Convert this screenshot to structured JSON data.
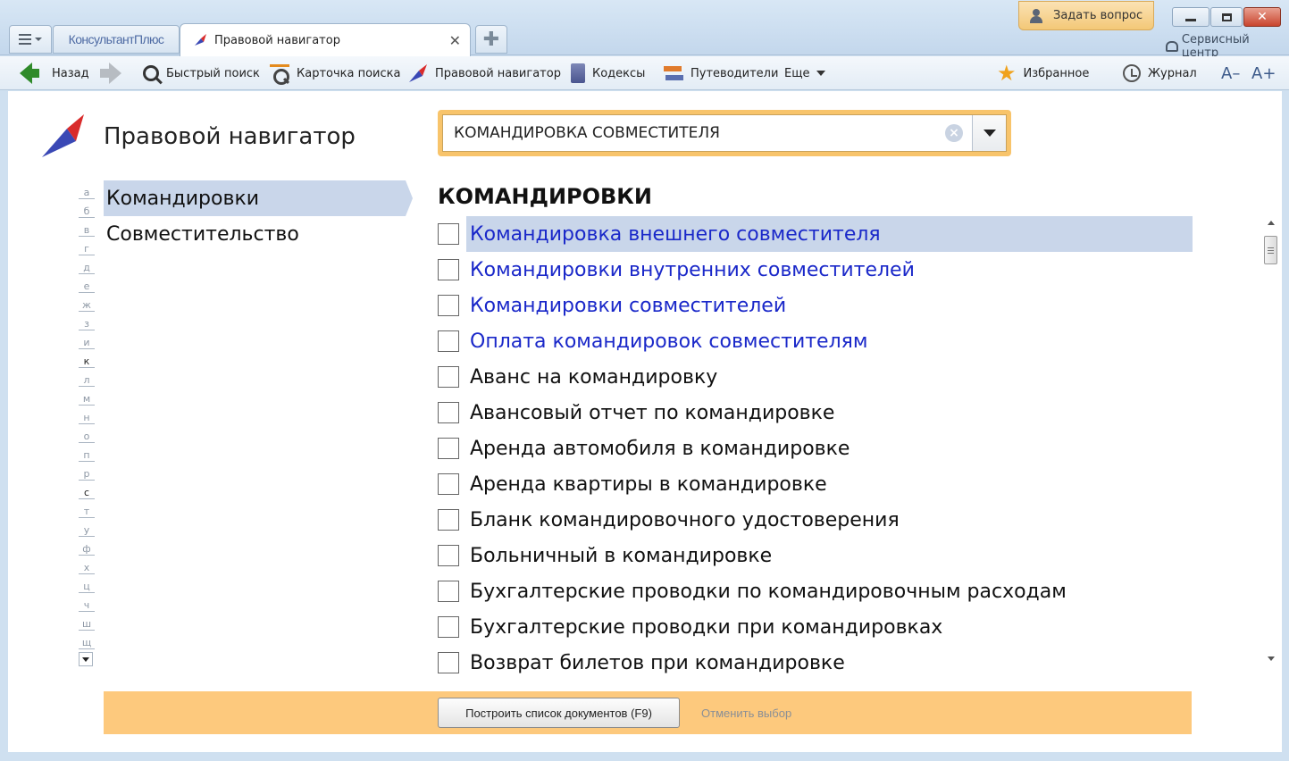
{
  "titlebar": {
    "home_tab": "КонсультантПлюс",
    "active_tab": "Правовой навигатор",
    "ask_button": "Задать вопрос",
    "service_center": "Сервисный центр"
  },
  "toolbar": {
    "back": "Назад",
    "quick_search": "Быстрый поиск",
    "search_card": "Карточка поиска",
    "legal_navigator": "Правовой навигатор",
    "codes": "Кодексы",
    "guides": "Путеводители",
    "more": "Еще",
    "favorites": "Избранное",
    "journal": "Журнал",
    "font_smaller": "A–",
    "font_larger": "A+"
  },
  "page": {
    "title": "Правовой навигатор",
    "search_value": "КОМАНДИРОВКА СОВМЕСТИТЕЛЯ"
  },
  "alphabet": [
    {
      "letter": "а",
      "on": false
    },
    {
      "letter": "б",
      "on": false
    },
    {
      "letter": "в",
      "on": false
    },
    {
      "letter": "г",
      "on": false
    },
    {
      "letter": "д",
      "on": false
    },
    {
      "letter": "е",
      "on": false
    },
    {
      "letter": "ж",
      "on": false
    },
    {
      "letter": "з",
      "on": false
    },
    {
      "letter": "и",
      "on": false
    },
    {
      "letter": "к",
      "on": true
    },
    {
      "letter": "л",
      "on": false
    },
    {
      "letter": "м",
      "on": false
    },
    {
      "letter": "н",
      "on": false
    },
    {
      "letter": "о",
      "on": false
    },
    {
      "letter": "п",
      "on": false
    },
    {
      "letter": "р",
      "on": false
    },
    {
      "letter": "с",
      "on": true
    },
    {
      "letter": "т",
      "on": false
    },
    {
      "letter": "у",
      "on": false
    },
    {
      "letter": "ф",
      "on": false
    },
    {
      "letter": "х",
      "on": false
    },
    {
      "letter": "ц",
      "on": false
    },
    {
      "letter": "ч",
      "on": false
    },
    {
      "letter": "ш",
      "on": false
    },
    {
      "letter": "щ",
      "on": false
    }
  ],
  "categories": [
    {
      "label": "Командировки",
      "active": true
    },
    {
      "label": "Совместительство",
      "active": false
    }
  ],
  "list": {
    "title": "КОМАНДИРОВКИ",
    "items": [
      {
        "label": "Командировка внешнего совместителя",
        "link": true,
        "highlighted": true
      },
      {
        "label": "Командировки внутренних совместителей",
        "link": true,
        "highlighted": false
      },
      {
        "label": "Командировки совместителей",
        "link": true,
        "highlighted": false
      },
      {
        "label": "Оплата командировок совместителям",
        "link": true,
        "highlighted": false
      },
      {
        "label": "Аванс на командировку",
        "link": false,
        "highlighted": false
      },
      {
        "label": "Авансовый отчет по командировке",
        "link": false,
        "highlighted": false
      },
      {
        "label": "Аренда автомобиля в командировке",
        "link": false,
        "highlighted": false
      },
      {
        "label": "Аренда квартиры в командировке",
        "link": false,
        "highlighted": false
      },
      {
        "label": "Бланк командировочного удостоверения",
        "link": false,
        "highlighted": false
      },
      {
        "label": "Больничный в командировке",
        "link": false,
        "highlighted": false
      },
      {
        "label": "Бухгалтерские проводки по командировочным расходам",
        "link": false,
        "highlighted": false
      },
      {
        "label": "Бухгалтерские проводки при командировках",
        "link": false,
        "highlighted": false
      },
      {
        "label": "Возврат билетов при командировке",
        "link": false,
        "highlighted": false
      }
    ]
  },
  "bottom": {
    "build_button": "Построить список документов (F9)",
    "cancel_link": "Отменить выбор"
  },
  "colors": {
    "accent_orange": "#fdc97d",
    "link_blue": "#1a28c9",
    "highlight": "#c9d6ea",
    "logo_red": "#d92b2b",
    "logo_blue": "#3a48b5"
  }
}
